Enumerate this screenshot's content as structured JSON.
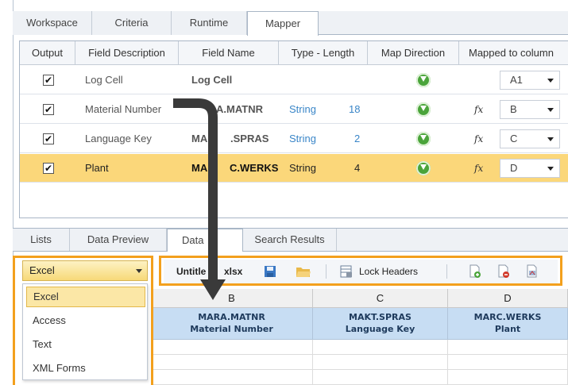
{
  "top_tabs": [
    "Workspace",
    "Criteria",
    "Runtime",
    "Mapper"
  ],
  "mapper": {
    "headers": [
      "Output",
      "Field Description",
      "Field Name",
      "Type - Length",
      "Map Direction",
      "Mapped to column"
    ],
    "rows": [
      {
        "checked": true,
        "description": "Log Cell",
        "field_name": "Log Cell",
        "type": "",
        "length": "",
        "has_formula": false,
        "column": "A1",
        "selected": false
      },
      {
        "checked": true,
        "description": "Material Number",
        "field_name": "MARA.MATNR",
        "field_name_visible": "A.MATNR",
        "type": "String",
        "length": "18",
        "has_formula": true,
        "column": "B",
        "selected": false
      },
      {
        "checked": true,
        "description": "Language Key",
        "field_name": "MAKT.SPRAS",
        "field_name_visible_left": "MA",
        "field_name_visible_right": ".SPRAS",
        "type": "String",
        "length": "2",
        "has_formula": true,
        "column": "C",
        "selected": false
      },
      {
        "checked": true,
        "description": "Plant",
        "field_name": "MARC.WERKS",
        "field_name_visible_left": "MA",
        "field_name_visible_right": "C.WERKS",
        "type": "String",
        "length": "4",
        "has_formula": true,
        "column": "D",
        "selected": true
      }
    ],
    "check_glyph": "✔",
    "direction_icon": "green-down-arrow-icon",
    "formula_icon": "fx-icon",
    "fx_text": "fx"
  },
  "bottom_tabs": [
    "Lists",
    "Data Preview",
    "Data ...",
    "Search Results"
  ],
  "bottom_tabs_visible": [
    "Lists",
    "Data Preview",
    "Data",
    "Search Results"
  ],
  "format_dropdown": {
    "selected": "Excel",
    "options": [
      "Excel",
      "Access",
      "Text",
      "XML Forms"
    ]
  },
  "toolbar": {
    "file_name_left": "Untitle",
    "file_name_right": "xlsx",
    "lock_headers": "Lock Headers",
    "icons": [
      "save-icon",
      "open-folder-icon",
      "lock-headers-icon",
      "add-sheet-icon",
      "remove-sheet-icon",
      "sheet-properties-icon"
    ]
  },
  "sheet": {
    "columns": [
      "B",
      "C",
      "D"
    ],
    "header_cells": [
      {
        "line1": "MARA.MATNR",
        "line2": "Material Number"
      },
      {
        "line1": "MAKT.SPRAS",
        "line2": "Language Key"
      },
      {
        "line1": "MARC.WERKS",
        "line2": "Plant"
      }
    ]
  },
  "colors": {
    "highlight": "#f3a01d",
    "selected_row": "#fbd77a",
    "sheet_header": "#c7ddf3",
    "arrow": "#333333"
  }
}
